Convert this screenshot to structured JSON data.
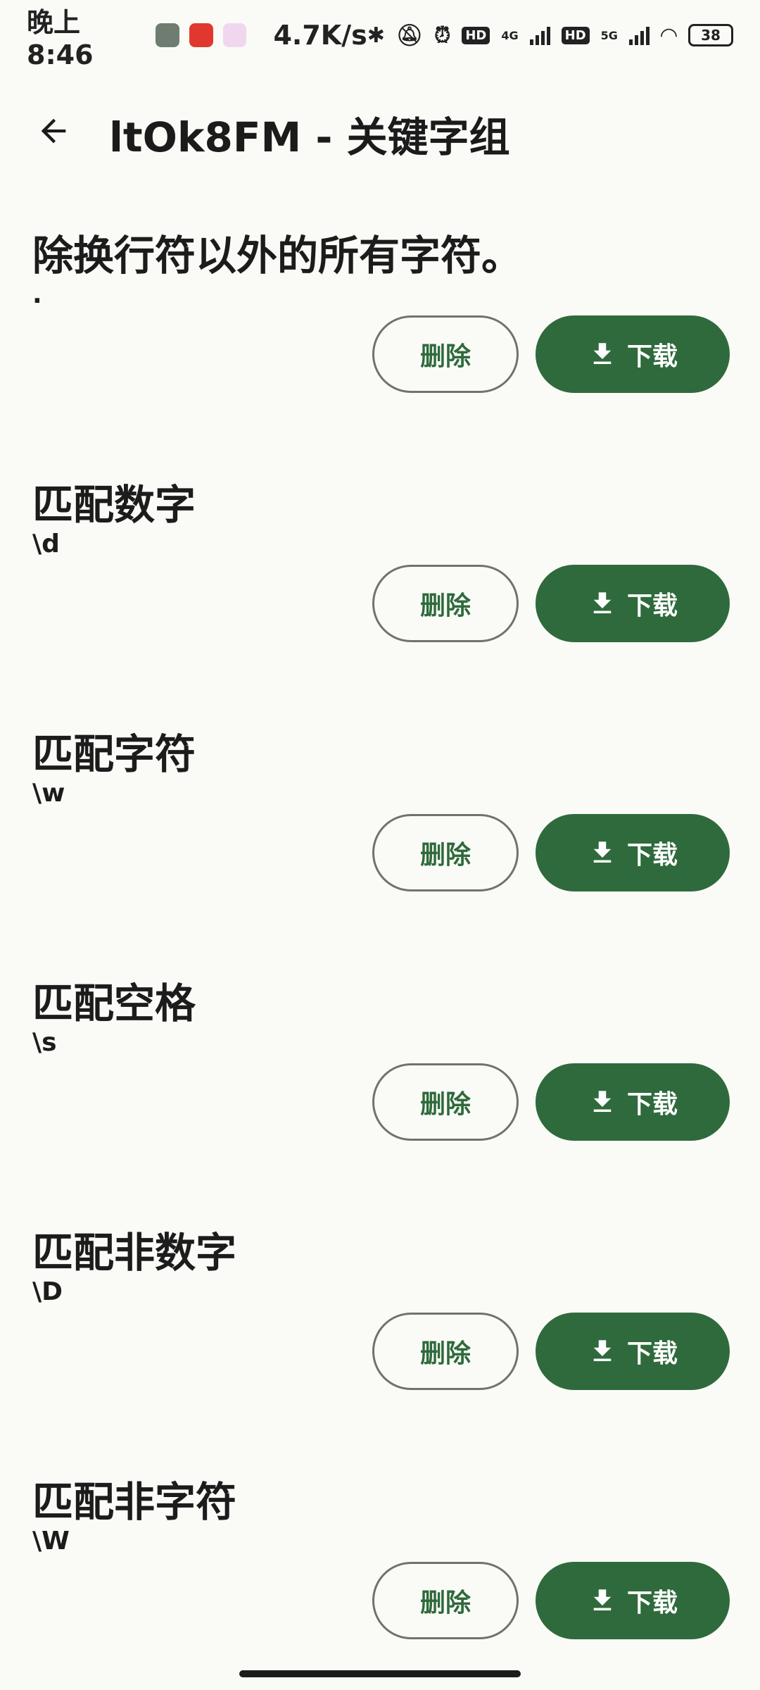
{
  "status_bar": {
    "time": "晚上8:46",
    "speed": "4.7K/s",
    "network_1": "4G",
    "network_2": "5G",
    "battery": "38"
  },
  "app_bar": {
    "title": "ltOk8FM - 关键字组"
  },
  "items": [
    {
      "title": "除换行符以外的所有字符。",
      "pattern": ".",
      "delete_label": "删除",
      "download_label": "下载"
    },
    {
      "title": "匹配数字",
      "pattern": "\\d",
      "delete_label": "删除",
      "download_label": "下载"
    },
    {
      "title": "匹配字符",
      "pattern": "\\w",
      "delete_label": "删除",
      "download_label": "下载"
    },
    {
      "title": "匹配空格",
      "pattern": "\\s",
      "delete_label": "删除",
      "download_label": "下载"
    },
    {
      "title": "匹配非数字",
      "pattern": "\\D",
      "delete_label": "删除",
      "download_label": "下载"
    },
    {
      "title": "匹配非字符",
      "pattern": "\\W",
      "delete_label": "删除",
      "download_label": "下载"
    }
  ],
  "colors": {
    "primary": "#2f6a3c",
    "background": "#fafbf7",
    "outline": "#6f736e"
  }
}
